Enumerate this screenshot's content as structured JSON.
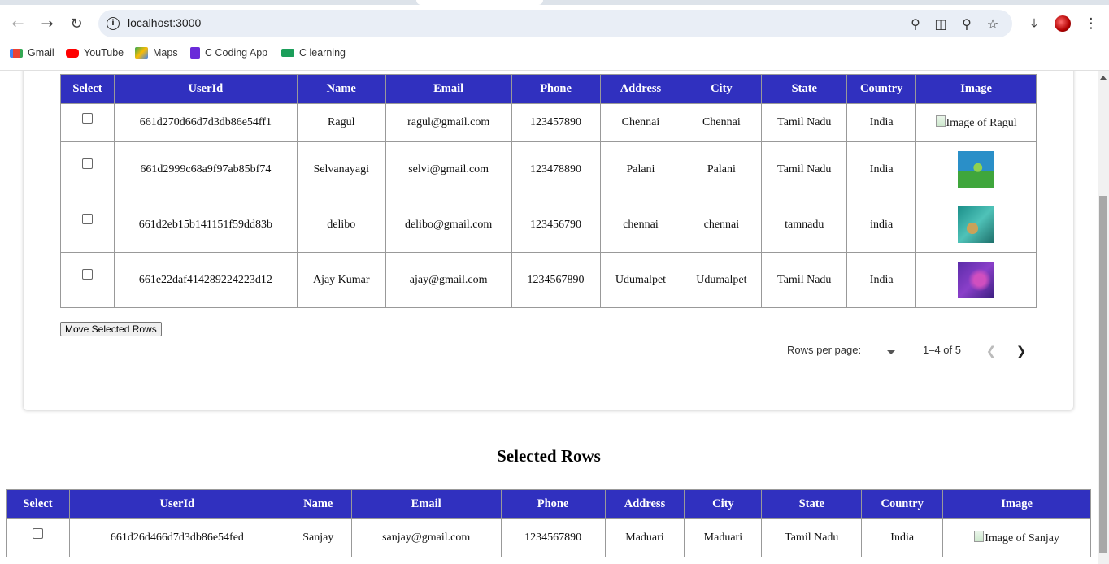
{
  "browser": {
    "url": "localhost:3000",
    "bookmarks": [
      "Gmail",
      "YouTube",
      "Maps",
      "C Coding App",
      "C learning"
    ]
  },
  "table": {
    "headers": [
      "Select",
      "UserId",
      "Name",
      "Email",
      "Phone",
      "Address",
      "City",
      "State",
      "Country",
      "Image"
    ],
    "rows": [
      {
        "id": "661d270d66d7d3db86e54ff1",
        "name": "Ragul",
        "email": "ragul@gmail.com",
        "phone": "123457890",
        "address": "Chennai",
        "city": "Chennai",
        "state": "Tamil Nadu",
        "country": "India",
        "image_alt": "Image of Ragul",
        "image_kind": "broken"
      },
      {
        "id": "661d2999c68a9f97ab85bf74",
        "name": "Selvanayagi",
        "email": "selvi@gmail.com",
        "phone": "123478890",
        "address": "Palani",
        "city": "Palani",
        "state": "Tamil Nadu",
        "country": "India",
        "image_kind": "thumb-green"
      },
      {
        "id": "661d2eb15b141151f59dd83b",
        "name": "delibo",
        "email": "delibo@gmail.com",
        "phone": "123456790",
        "address": "chennai",
        "city": "chennai",
        "state": "tamnadu",
        "country": "india",
        "image_kind": "thumb-teal"
      },
      {
        "id": "661e22daf414289224223d12",
        "name": "Ajay Kumar",
        "email": "ajay@gmail.com",
        "phone": "1234567890",
        "address": "Udumalpet",
        "city": "Udumalpet",
        "state": "Tamil Nadu",
        "country": "India",
        "image_kind": "thumb-purple"
      }
    ]
  },
  "move_button": "Move Selected Rows",
  "pagination": {
    "rows_per_page_label": "Rows per page:",
    "range": "1–4 of 5"
  },
  "selected": {
    "title": "Selected Rows",
    "headers": [
      "Select",
      "UserId",
      "Name",
      "Email",
      "Phone",
      "Address",
      "City",
      "State",
      "Country",
      "Image"
    ],
    "rows": [
      {
        "id": "661d26d466d7d3db86e54fed",
        "name": "Sanjay",
        "email": "sanjay@gmail.com",
        "phone": "1234567890",
        "address": "Maduari",
        "city": "Maduari",
        "state": "Tamil Nadu",
        "country": "India",
        "image_alt": "Image of Sanjay",
        "image_kind": "broken"
      }
    ]
  },
  "colors": {
    "header_bg": "#3030bf"
  }
}
